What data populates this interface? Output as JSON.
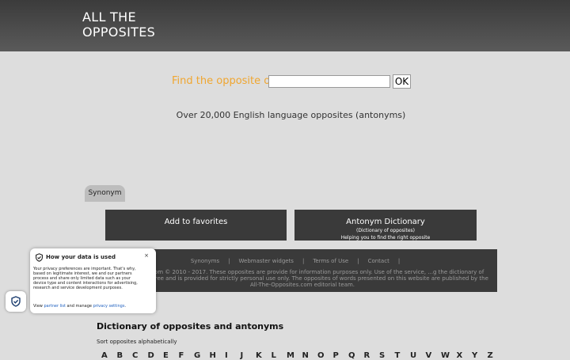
{
  "header": {
    "logo_line1": "ALL THE",
    "logo_line2": "OPPOSITES"
  },
  "search": {
    "label": "Find the opposite of",
    "placeholder": "",
    "button": "OK"
  },
  "tagline": "Over 20,000 English language opposites (antonyms)",
  "tab": {
    "label": "Synonym"
  },
  "buttons": {
    "favorites": "Add to favorites",
    "dictionary": "Antonym Dictionary",
    "dictionary_sub1": "(Dictionary of opposites)",
    "dictionary_sub2": "Helping you to find the right opposite"
  },
  "footer": {
    "links": [
      "Synonyms",
      "Webmaster widgets",
      "Terms of Use",
      "Contact"
    ],
    "text": "...pposites.com © 2010 - 2017. These opposites are provide for information purposes only. Use of the service, ...g the dictionary of opposites, is free and is provided for strictly personal use only. The opposites of words presented on this website are published by the All-The-Opposites.com editorial team."
  },
  "dictionary": {
    "title": "Dictionary of opposites and antonyms",
    "sort_label": "Sort opposites alphabetically",
    "letters": [
      "A",
      "B",
      "C",
      "D",
      "E",
      "F",
      "G",
      "H",
      "I",
      "J",
      "K",
      "L",
      "M",
      "N",
      "O",
      "P",
      "Q",
      "R",
      "S",
      "T",
      "U",
      "V",
      "W",
      "X",
      "Y",
      "Z"
    ]
  },
  "privacy": {
    "title": "How your data is used",
    "close": "×",
    "body": "Your privacy preferences are important. That's why, based on legitimate interest, we and our partners process and share only limited data such as your device type and content interactions for advertising, research and service development purposes.",
    "links_prefix": "View ",
    "partner_list": "partner list",
    "links_mid": " and manage ",
    "privacy_settings": "privacy settings",
    "links_suffix": "."
  },
  "colors": {
    "accent": "#f0a630",
    "header_bg": "#3b3b3b",
    "dark_panel": "#3a3a3a",
    "link_blue": "#1d5fbf"
  }
}
